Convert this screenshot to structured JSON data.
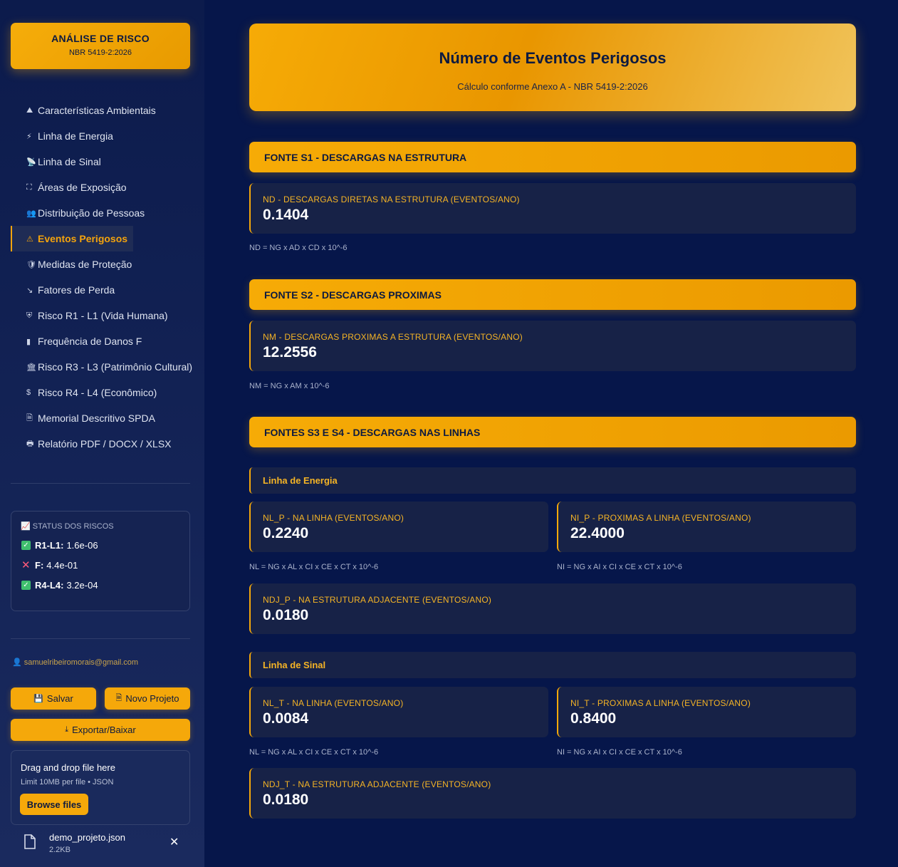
{
  "brand": {
    "title": "ANÁLISE DE RISCO",
    "subtitle": "NBR 5419-2:2026"
  },
  "nav": [
    {
      "icon": "⛰",
      "label": "Características Ambientais"
    },
    {
      "icon": "⚡",
      "label": "Linha de Energia"
    },
    {
      "icon": "📡",
      "label": "Linha de Sinal"
    },
    {
      "icon": "⛶",
      "label": "Áreas de Exposição"
    },
    {
      "icon": "👥",
      "label": "Distribuição de Pessoas"
    },
    {
      "icon": "⚠",
      "label": "Eventos Perigosos",
      "active": true
    },
    {
      "icon": "🛡",
      "label": "Medidas de Proteção"
    },
    {
      "icon": "↘",
      "label": "Fatores de Perda"
    },
    {
      "icon": "⛨",
      "label": "Risco R1 - L1 (Vida Humana)"
    },
    {
      "icon": "▮",
      "label": "Frequência de Danos F"
    },
    {
      "icon": "🏛",
      "label": "Risco R3 - L3 (Patrimônio Cultural)"
    },
    {
      "icon": "$",
      "label": "Risco R4 - L4 (Econômico)"
    },
    {
      "icon": "🗎",
      "label": "Memorial Descritivo SPDA"
    },
    {
      "icon": "🖶",
      "label": "Relatório PDF / DOCX / XLSX"
    }
  ],
  "status": {
    "title": "STATUS DOS RISCOS",
    "rows": [
      {
        "label": "R1-L1:",
        "value": "1.6e-06",
        "ok": true
      },
      {
        "label": "F:",
        "value": "4.4e-01",
        "ok": false
      },
      {
        "label": "R4-L4:",
        "value": "3.2e-04",
        "ok": true
      }
    ]
  },
  "user": {
    "email": "samuelribeiromorais@gmail.com"
  },
  "buttons": {
    "save": "Salvar",
    "new_project": "Novo Projeto",
    "export": "Exportar/Baixar"
  },
  "uploader": {
    "title": "Drag and drop file here",
    "subtitle": "Limit 10MB per file • JSON",
    "browse": "Browse files"
  },
  "file": {
    "name": "demo_projeto.json",
    "size": "2.2KB"
  },
  "hero": {
    "title": "Número de Eventos Perigosos",
    "subtitle": "Cálculo conforme Anexo A - NBR 5419-2:2026"
  },
  "sections": {
    "s1": {
      "title": "FONTE S1 - DESCARGAS NA ESTRUTURA",
      "nd_label": "ND - DESCARGAS DIRETAS NA ESTRUTURA (EVENTOS/ANO)",
      "nd_value": "0.1404",
      "formula": "ND = NG x AD x CD x 10^-6"
    },
    "s2": {
      "title": "FONTE S2 - DESCARGAS PROXIMAS",
      "nm_label": "NM - DESCARGAS PROXIMAS A ESTRUTURA (EVENTOS/ANO)",
      "nm_value": "12.2556",
      "formula": "NM = NG x AM x 10^-6"
    },
    "s34": {
      "title": "FONTES S3 E S4 - DESCARGAS NAS LINHAS",
      "energia": {
        "title": "Linha de Energia",
        "nl_label": "NL_P - NA LINHA (EVENTOS/ANO)",
        "nl_value": "0.2240",
        "nl_formula": "NL = NG x AL x CI x CE x CT x 10^-6",
        "ni_label": "NI_P - PROXIMAS A LINHA (EVENTOS/ANO)",
        "ni_value": "22.4000",
        "ni_formula": "NI = NG x AI x CI x CE x CT x 10^-6",
        "ndj_label": "NDJ_P - NA ESTRUTURA ADJACENTE (EVENTOS/ANO)",
        "ndj_value": "0.0180"
      },
      "sinal": {
        "title": "Linha de Sinal",
        "nl_label": "NL_T - NA LINHA (EVENTOS/ANO)",
        "nl_value": "0.0084",
        "nl_formula": "NL = NG x AL x CI x CE x CT x 10^-6",
        "ni_label": "NI_T - PROXIMAS A LINHA (EVENTOS/ANO)",
        "ni_value": "0.8400",
        "ni_formula": "NI = NG x AI x CI x CE x CT x 10^-6",
        "ndj_label": "NDJ_T - NA ESTRUTURA ADJACENTE (EVENTOS/ANO)",
        "ndj_value": "0.0180"
      }
    }
  },
  "colors": {
    "accent": "#f5a80a",
    "background": "#06164a",
    "card": "#172247"
  }
}
